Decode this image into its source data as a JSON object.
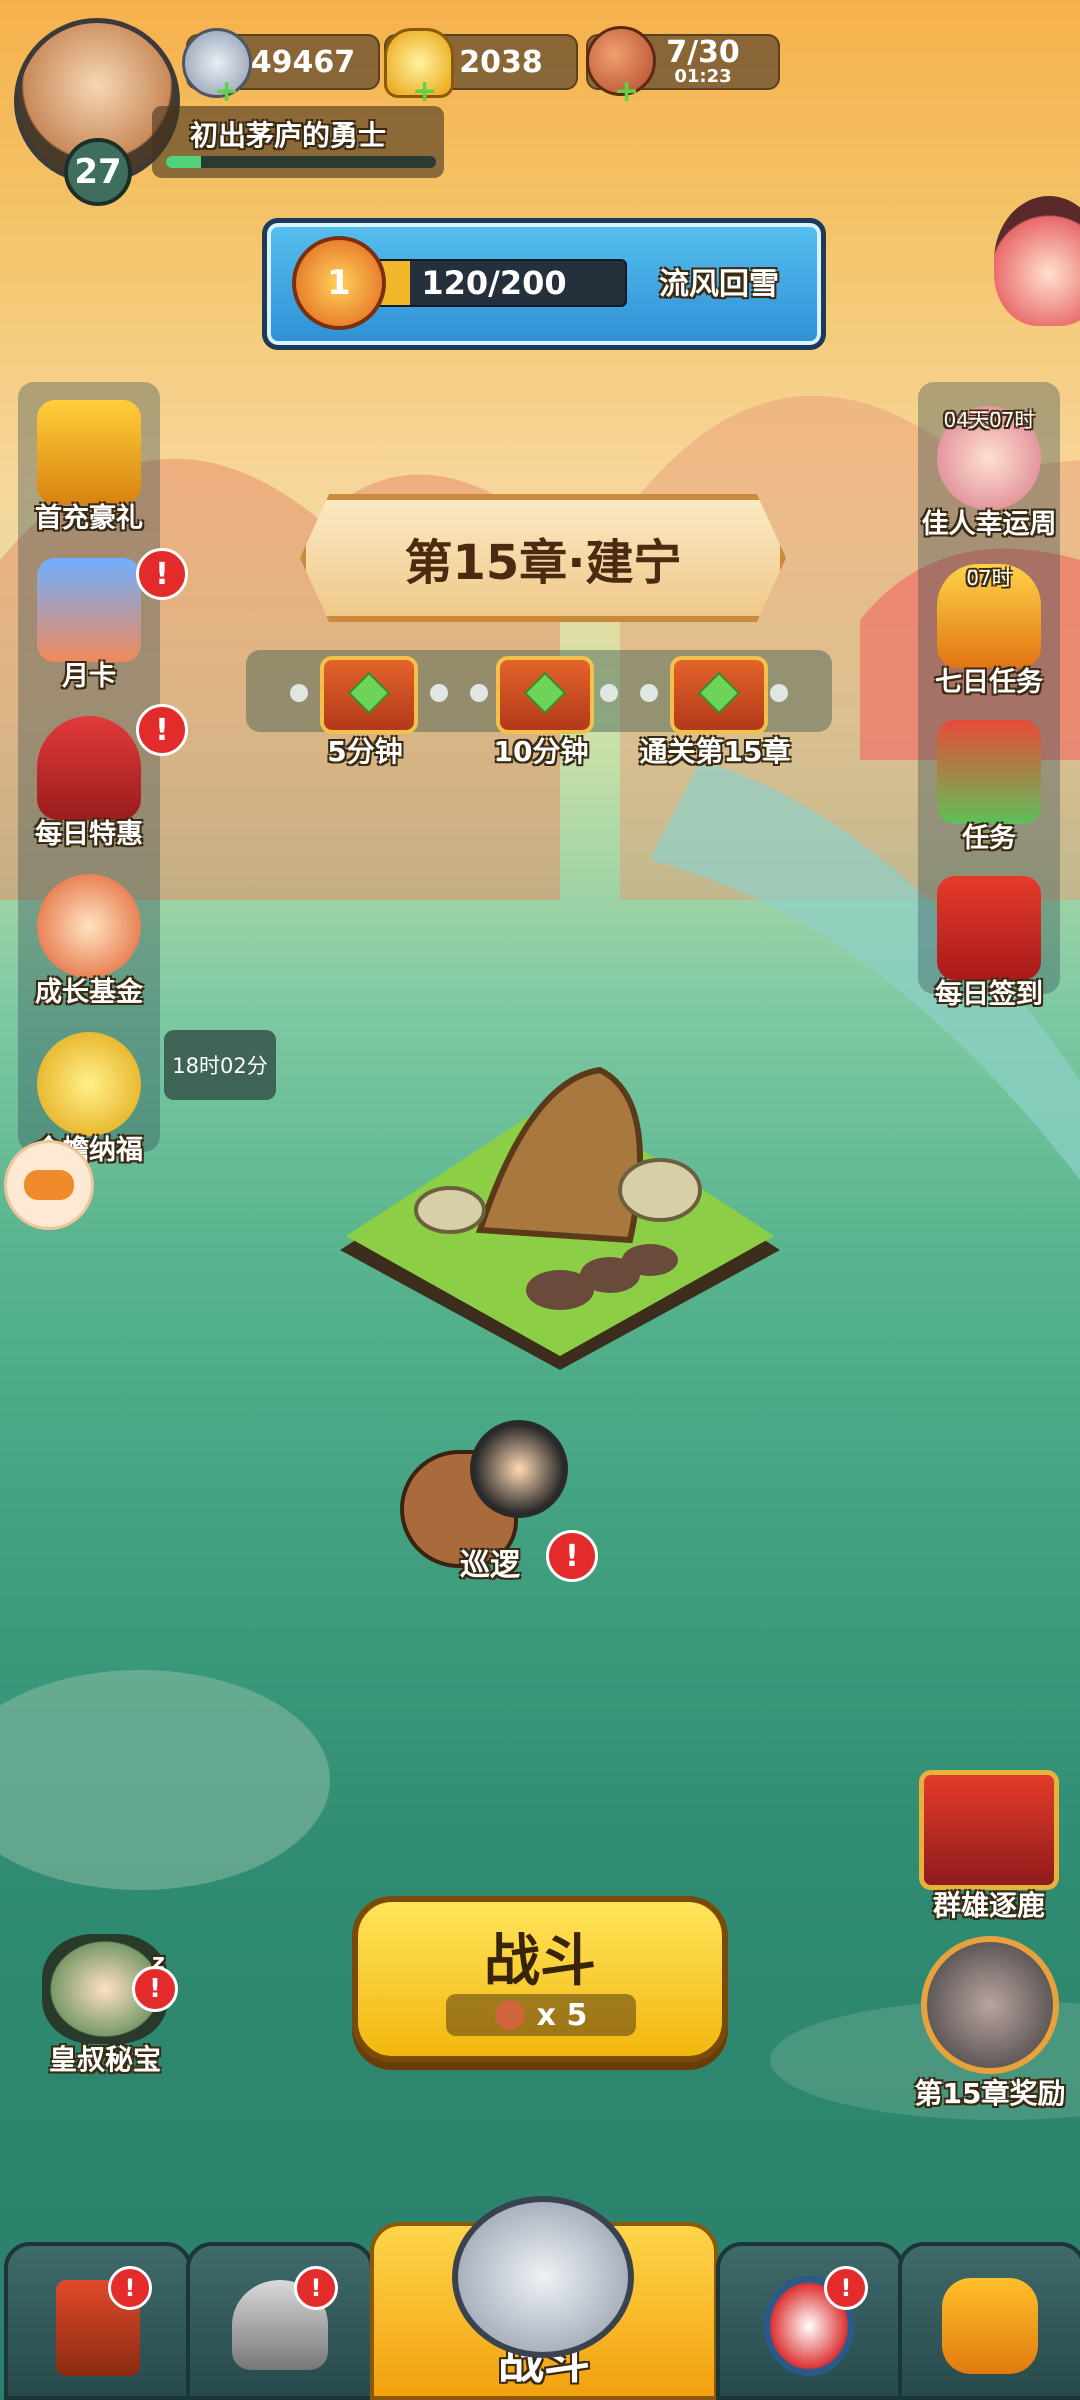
{
  "player": {
    "level": "27",
    "title": "初出茅庐的勇士"
  },
  "resources": {
    "silver": "49467",
    "gold": "2038",
    "stamina": "7/30",
    "stamina_timer": "01:23"
  },
  "season": {
    "rank": "1",
    "progress": "120/200",
    "name": "流风回雪"
  },
  "left_menu": [
    {
      "label": "首充豪礼"
    },
    {
      "label": "月卡"
    },
    {
      "label": "每日特惠"
    },
    {
      "label": "成长基金"
    },
    {
      "label": "金蟾纳福",
      "timer": "18时02分"
    }
  ],
  "right_menu": [
    {
      "label": "佳人幸运周",
      "timer": "04天07时"
    },
    {
      "label": "七日任务",
      "timer": "07时"
    },
    {
      "label": "任务"
    },
    {
      "label": "每日签到"
    }
  ],
  "chapter": {
    "title": "第15章·建宁",
    "rewards": [
      "5分钟",
      "10分钟",
      "通关第15章"
    ]
  },
  "patrol": {
    "label": "巡逻"
  },
  "events": {
    "qunxiong": "群雄逐鹿",
    "chapter_reward": "第15章奖励",
    "huangshu": "皇叔秘宝",
    "huangshu_z": "z"
  },
  "battle": {
    "label": "战斗",
    "cost": "x 5"
  },
  "bottom_nav": {
    "center_label": "战斗"
  },
  "badge_mark": "!"
}
